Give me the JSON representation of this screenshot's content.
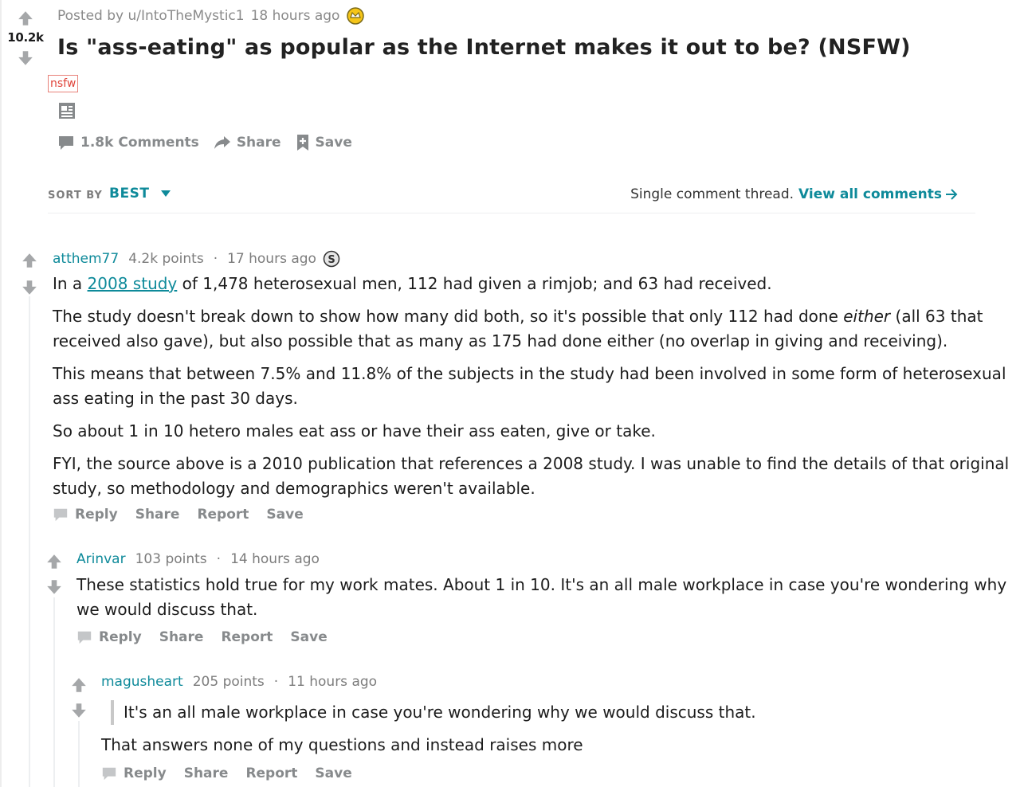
{
  "post": {
    "score": "10.2k",
    "posted_by": "Posted by u/IntoTheMystic1",
    "time": "18 hours ago",
    "title": "Is \"ass-eating\" as popular as the Internet makes it out to be? (NSFW)",
    "nsfw_tag": "nsfw",
    "actions": {
      "comments": "1.8k Comments",
      "share": "Share",
      "save": "Save"
    }
  },
  "sort": {
    "label": "SORT BY",
    "value": "BEST"
  },
  "thread": {
    "note": "Single comment thread.",
    "view_all": "View all comments"
  },
  "comments": [
    {
      "author": "atthem77",
      "points": "4.2k points",
      "time": "17 hours ago",
      "p1_pre": "In a ",
      "p1_link": "2008 study",
      "p1_post": " of 1,478 heterosexual men, 112 had given a rimjob; and 63 had received.",
      "p2a_pre": "The study doesn't break down to show how many did both, so it's possible that only 112 had done ",
      "p2a_em": "either",
      "p2a_post": " (all 63 that",
      "p2b": "received also gave), but also possible that as many as 175 had done either (no overlap in giving and receiving).",
      "p3a": "This means that between 7.5% and 11.8% of the subjects in the study had been involved in some form of heterosexual",
      "p3b": "ass eating in the past 30 days.",
      "p4": "So about 1 in 10 hetero males eat ass or have their ass eaten, give or take.",
      "p5a": "FYI, the source above is a 2010 publication that references a 2008 study. I was unable to find the details of that original",
      "p5b": "study, so methodology and demographics weren't available.",
      "actions": {
        "reply": "Reply",
        "share": "Share",
        "report": "Report",
        "save": "Save"
      }
    },
    {
      "author": "Arinvar",
      "points": "103 points",
      "time": "14 hours ago",
      "p1a": "These statistics hold true for my work mates. About 1 in 10. It's an all male workplace in case you're wondering why",
      "p1b": "we would discuss that.",
      "actions": {
        "reply": "Reply",
        "share": "Share",
        "report": "Report",
        "save": "Save"
      }
    },
    {
      "author": "magusheart",
      "points": "205 points",
      "time": "11 hours ago",
      "quote": "It's an all male workplace in case you're wondering why we would discuss that.",
      "p1": "That answers none of my questions and instead raises more",
      "actions": {
        "reply": "Reply",
        "share": "Share",
        "report": "Report",
        "save": "Save"
      }
    }
  ],
  "colors": {
    "accent": "#0e8a9a",
    "meta": "#878a8c",
    "nsfw": "#e0443a"
  }
}
